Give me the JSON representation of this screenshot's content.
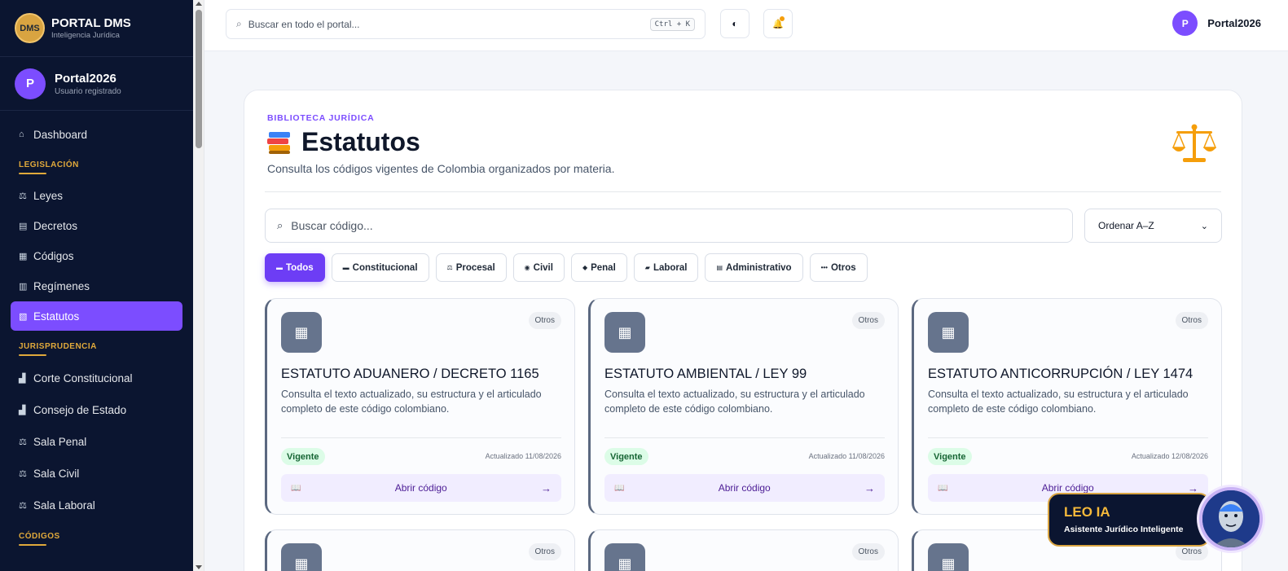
{
  "brand": {
    "logo": "DMS",
    "title": "PORTAL DMS",
    "subtitle": "Inteligencia Jurídica"
  },
  "sidebar_user": {
    "initial": "P",
    "name": "Portal2026",
    "role": "Usuario registrado"
  },
  "sidebar": {
    "dashboard": {
      "icon": "⌂",
      "label": "Dashboard"
    },
    "sections": [
      {
        "title": "LEGISLACIÓN",
        "items": [
          {
            "icon": "⚖",
            "label": "Leyes"
          },
          {
            "icon": "▤",
            "label": "Decretos"
          },
          {
            "icon": "▦",
            "label": "Códigos"
          },
          {
            "icon": "▥",
            "label": "Regímenes"
          },
          {
            "icon": "▧",
            "label": "Estatutos",
            "active": true
          }
        ]
      },
      {
        "title": "JURISPRUDENCIA",
        "items": [
          {
            "icon": "▟",
            "label": "Corte Constitucional"
          },
          {
            "icon": "▟",
            "label": "Consejo de Estado"
          },
          {
            "icon": "⚖",
            "label": "Sala Penal"
          },
          {
            "icon": "⚖",
            "label": "Sala Civil"
          },
          {
            "icon": "⚖",
            "label": "Sala Laboral"
          }
        ]
      },
      {
        "title": "CÓDIGOS",
        "items": []
      }
    ]
  },
  "topbar": {
    "search_placeholder": "Buscar en todo el portal...",
    "shortcut": "Ctrl + K",
    "theme_icon": "◐",
    "bell_icon": "🔔",
    "user_initial": "P",
    "user_name": "Portal2026"
  },
  "page": {
    "kicker": "BIBLIOTECA JURÍDICA",
    "title": "Estatutos",
    "subtitle": "Consulta los códigos vigentes de Colombia organizados por materia.",
    "search_placeholder": "Buscar código...",
    "sort_selected": "Ordenar A–Z",
    "filters": [
      {
        "icon": "▬",
        "label": "Todos",
        "active": true
      },
      {
        "icon": "▬",
        "label": "Constitucional"
      },
      {
        "icon": "⚖",
        "label": "Procesal"
      },
      {
        "icon": "◉",
        "label": "Civil"
      },
      {
        "icon": "◆",
        "label": "Penal"
      },
      {
        "icon": "▰",
        "label": "Laboral"
      },
      {
        "icon": "▤",
        "label": "Administrativo"
      },
      {
        "icon": "•••",
        "label": "Otros"
      }
    ]
  },
  "cards": [
    {
      "icon": "▦",
      "tag": "Otros",
      "title": "ESTATUTO ADUANERO / DECRETO 1165",
      "desc": "Consulta el texto actualizado, su estructura y el articulado completo de este código colombiano.",
      "status": "Vigente",
      "updated": "Actualizado 11/08/2026",
      "button": "Abrir código",
      "btn_icon": "📖",
      "arrow": "→"
    },
    {
      "icon": "▦",
      "tag": "Otros",
      "title": "ESTATUTO AMBIENTAL / LEY 99",
      "desc": "Consulta el texto actualizado, su estructura y el articulado completo de este código colombiano.",
      "status": "Vigente",
      "updated": "Actualizado 11/08/2026",
      "button": "Abrir código",
      "btn_icon": "📖",
      "arrow": "→"
    },
    {
      "icon": "▦",
      "tag": "Otros",
      "title": "ESTATUTO ANTICORRUPCIÓN / LEY 1474",
      "desc": "Consulta el texto actualizado, su estructura y el articulado completo de este código colombiano.",
      "status": "Vigente",
      "updated": "Actualizado 12/08/2026",
      "button": "Abrir código",
      "btn_icon": "📖",
      "arrow": "→"
    }
  ],
  "partial_cards": [
    {
      "icon": "▦",
      "tag": "Otros"
    },
    {
      "icon": "▦",
      "tag": "Otros"
    },
    {
      "icon": "▦",
      "tag": "Otros"
    }
  ],
  "leo": {
    "name": "LEO IA",
    "subtitle": "Asistente Jurídico Inteligente"
  },
  "colors": {
    "accent": "#7c4dff",
    "sidebar_bg": "#0b1530",
    "gold": "#e0a93b",
    "vigente": "#dcfce7"
  }
}
